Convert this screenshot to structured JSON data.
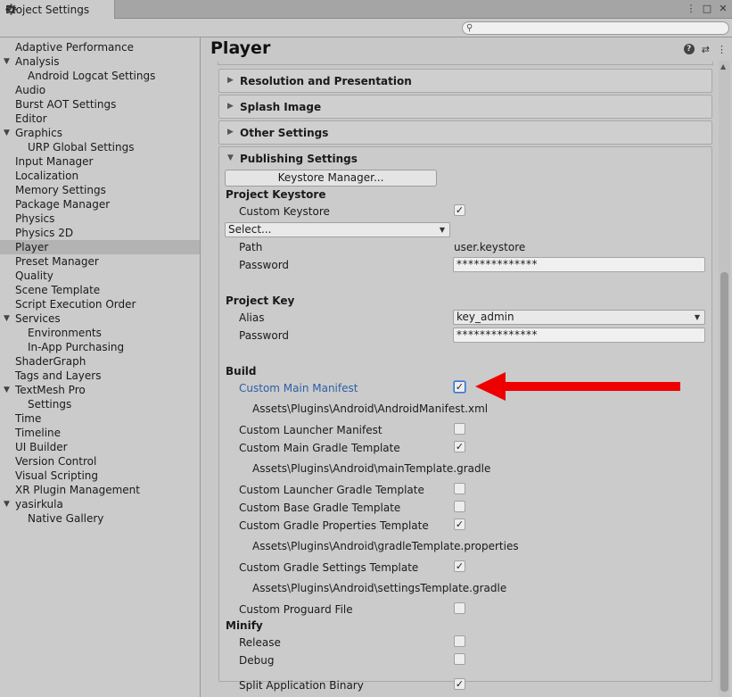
{
  "window": {
    "tab_title": "Project Settings",
    "controls": [
      "⋮",
      "□",
      "✕"
    ]
  },
  "sidebar": {
    "items": [
      {
        "label": "Adaptive Performance",
        "level": 0
      },
      {
        "label": "Analysis",
        "level": 0,
        "expanded": true
      },
      {
        "label": "Android Logcat Settings",
        "level": 1
      },
      {
        "label": "Audio",
        "level": 0
      },
      {
        "label": "Burst AOT Settings",
        "level": 0
      },
      {
        "label": "Editor",
        "level": 0
      },
      {
        "label": "Graphics",
        "level": 0,
        "expanded": true
      },
      {
        "label": "URP Global Settings",
        "level": 1
      },
      {
        "label": "Input Manager",
        "level": 0
      },
      {
        "label": "Localization",
        "level": 0
      },
      {
        "label": "Memory Settings",
        "level": 0
      },
      {
        "label": "Package Manager",
        "level": 0
      },
      {
        "label": "Physics",
        "level": 0
      },
      {
        "label": "Physics 2D",
        "level": 0
      },
      {
        "label": "Player",
        "level": 0,
        "selected": true
      },
      {
        "label": "Preset Manager",
        "level": 0
      },
      {
        "label": "Quality",
        "level": 0
      },
      {
        "label": "Scene Template",
        "level": 0
      },
      {
        "label": "Script Execution Order",
        "level": 0
      },
      {
        "label": "Services",
        "level": 0,
        "expanded": true
      },
      {
        "label": "Environments",
        "level": 1
      },
      {
        "label": "In-App Purchasing",
        "level": 1
      },
      {
        "label": "ShaderGraph",
        "level": 0
      },
      {
        "label": "Tags and Layers",
        "level": 0
      },
      {
        "label": "TextMesh Pro",
        "level": 0,
        "expanded": true
      },
      {
        "label": "Settings",
        "level": 1
      },
      {
        "label": "Time",
        "level": 0
      },
      {
        "label": "Timeline",
        "level": 0
      },
      {
        "label": "UI Builder",
        "level": 0
      },
      {
        "label": "Version Control",
        "level": 0
      },
      {
        "label": "Visual Scripting",
        "level": 0
      },
      {
        "label": "XR Plugin Management",
        "level": 0
      },
      {
        "label": "yasirkula",
        "level": 0,
        "expanded": true
      },
      {
        "label": "Native Gallery",
        "level": 1
      }
    ]
  },
  "main": {
    "title": "Player",
    "sections": {
      "resolution": "Resolution and Presentation",
      "splash": "Splash Image",
      "other": "Other Settings",
      "publishing": "Publishing Settings"
    },
    "keystore_manager_button": "Keystore Manager...",
    "project_keystore": {
      "heading": "Project Keystore",
      "custom_keystore_label": "Custom Keystore",
      "custom_keystore_checked": true,
      "select_value": "Select...",
      "path_label": "Path",
      "path_value": "user.keystore",
      "password_label": "Password",
      "password_value": "**************"
    },
    "project_key": {
      "heading": "Project Key",
      "alias_label": "Alias",
      "alias_value": "key_admin",
      "password_label": "Password",
      "password_value": "**************"
    },
    "build": {
      "heading": "Build",
      "custom_main_manifest": "Custom Main Manifest",
      "custom_main_manifest_path": "Assets\\Plugins\\Android\\AndroidManifest.xml",
      "custom_launcher_manifest": "Custom Launcher Manifest",
      "custom_main_gradle": "Custom Main Gradle Template",
      "custom_main_gradle_path": "Assets\\Plugins\\Android\\mainTemplate.gradle",
      "custom_launcher_gradle": "Custom Launcher Gradle Template",
      "custom_base_gradle": "Custom Base Gradle Template",
      "custom_gradle_properties": "Custom Gradle Properties Template",
      "custom_gradle_properties_path": "Assets\\Plugins\\Android\\gradleTemplate.properties",
      "custom_gradle_settings": "Custom Gradle Settings Template",
      "custom_gradle_settings_path": "Assets\\Plugins\\Android\\settingsTemplate.gradle",
      "custom_proguard": "Custom Proguard File"
    },
    "minify": {
      "heading": "Minify",
      "release": "Release",
      "debug": "Debug"
    },
    "split_binary": "Split Application Binary",
    "check_mark": "✓"
  },
  "annotation": {
    "arrow_color": "#ee0000"
  }
}
